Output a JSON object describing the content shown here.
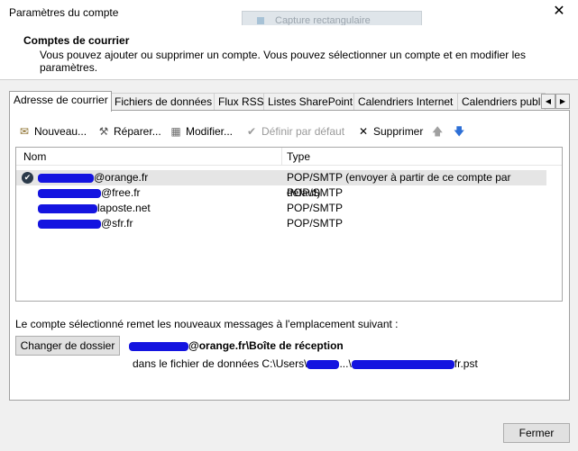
{
  "window": {
    "title": "Paramètres du compte",
    "close_glyph": "✕",
    "overlay_label": "Capture rectangulaire"
  },
  "header": {
    "title": "Comptes de courrier",
    "description": "Vous pouvez ajouter ou supprimer un compte. Vous pouvez sélectionner un compte et en modifier les paramètres."
  },
  "tabs": [
    {
      "label": "Adresse de courrier",
      "active": true
    },
    {
      "label": "Fichiers de données",
      "active": false
    },
    {
      "label": "Flux RSS",
      "active": false
    },
    {
      "label": "Listes SharePoint",
      "active": false
    },
    {
      "label": "Calendriers Internet",
      "active": false
    },
    {
      "label": "Calendriers publi",
      "active": false
    }
  ],
  "tab_arrows": {
    "left": "◀",
    "right": "▶"
  },
  "toolbar": {
    "new": {
      "label": "Nouveau...",
      "icon": "new-account-icon",
      "glyph": "✉"
    },
    "repair": {
      "label": "Réparer...",
      "icon": "repair-tools-icon",
      "glyph": "⚒"
    },
    "modify": {
      "label": "Modifier...",
      "icon": "modify-icon",
      "glyph": "▦"
    },
    "default": {
      "label": "Définir par défaut",
      "icon": "check-circle-icon",
      "glyph": "✔",
      "disabled": true
    },
    "delete": {
      "label": "Supprimer",
      "icon": "delete-x-icon",
      "glyph": "✕"
    },
    "up": {
      "icon": "arrow-up-icon",
      "glyph": "🡅",
      "color": "#a0a0a0"
    },
    "down": {
      "icon": "arrow-down-icon",
      "glyph": "🡇",
      "color": "#2d6fd6"
    }
  },
  "accounts_table": {
    "columns": [
      "Nom",
      "Type"
    ],
    "rows": [
      {
        "name_suffix": "@orange.fr",
        "type": "POP/SMTP (envoyer à partir de ce compte par défaut)",
        "default": true,
        "selected": true
      },
      {
        "name_suffix": "@free.fr",
        "type": "POP/SMTP",
        "default": false,
        "selected": false
      },
      {
        "name_suffix": "laposte.net",
        "type": "POP/SMTP",
        "default": false,
        "selected": false
      },
      {
        "name_suffix": "@sfr.fr",
        "type": "POP/SMTP",
        "default": false,
        "selected": false
      }
    ]
  },
  "delivery": {
    "label": "Le compte sélectionné remet les nouveaux messages à l'emplacement suivant :",
    "change_button": "Changer de dossier",
    "folder_suffix": "@orange.fr\\Boîte de réception",
    "file_prefix": "dans le fichier de données C:\\Users\\",
    "file_mid": "...\\",
    "file_suffix": "fr.pst"
  },
  "footer": {
    "close_button": "Fermer"
  },
  "colors": {
    "redaction": "#1414e0",
    "selected_row": "#e5e5e5",
    "button_bg": "#e1e1e1"
  }
}
